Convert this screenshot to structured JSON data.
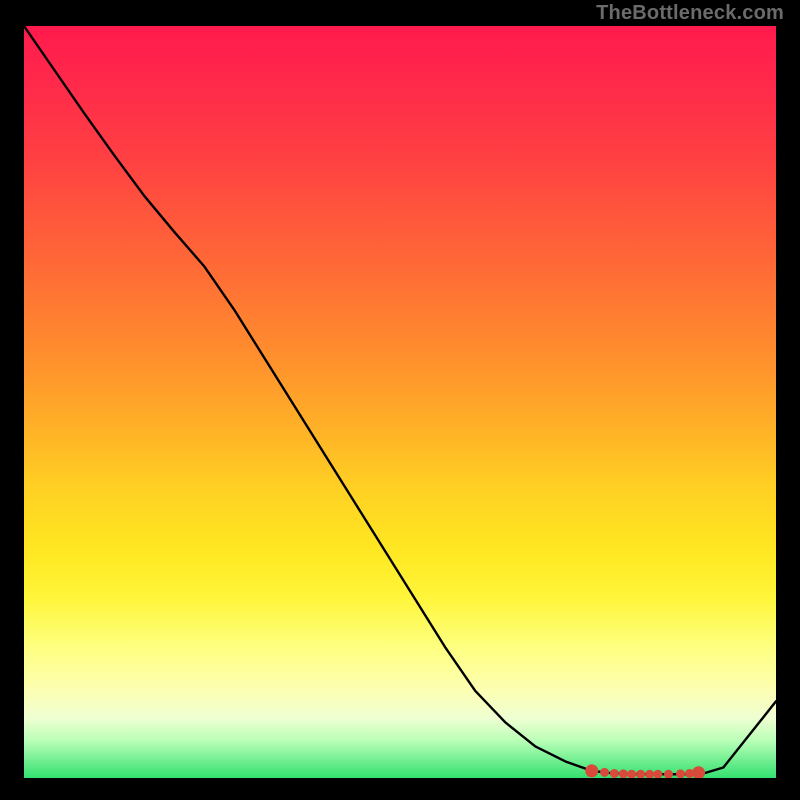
{
  "attribution": "TheBottleneck.com",
  "chart_data": {
    "type": "line",
    "title": "",
    "xlabel": "",
    "ylabel": "",
    "x": [
      0.0,
      0.04,
      0.08,
      0.12,
      0.16,
      0.2,
      0.24,
      0.28,
      0.32,
      0.36,
      0.4,
      0.44,
      0.48,
      0.52,
      0.56,
      0.6,
      0.64,
      0.68,
      0.72,
      0.755,
      0.78,
      0.8,
      0.82,
      0.835,
      0.852,
      0.87,
      0.885,
      0.905,
      0.93,
      0.965,
      1.0
    ],
    "y": [
      1.0,
      0.942,
      0.884,
      0.828,
      0.774,
      0.726,
      0.68,
      0.622,
      0.558,
      0.494,
      0.43,
      0.366,
      0.302,
      0.238,
      0.174,
      0.116,
      0.074,
      0.042,
      0.022,
      0.0095,
      0.0065,
      0.0055,
      0.005,
      0.005,
      0.005,
      0.005,
      0.005,
      0.0065,
      0.014,
      0.058,
      0.102
    ],
    "xlim": [
      0,
      1
    ],
    "ylim_note": "y values are normalized chart-height fractions measured from the bottom of the gradient plot area",
    "marker_cluster": {
      "x": [
        0.755,
        0.772,
        0.785,
        0.797,
        0.808,
        0.82,
        0.832,
        0.843,
        0.857,
        0.873,
        0.885,
        0.897
      ],
      "y": [
        0.0095,
        0.0075,
        0.006,
        0.0055,
        0.005,
        0.005,
        0.005,
        0.005,
        0.005,
        0.0055,
        0.006,
        0.007
      ],
      "radius": [
        6,
        4,
        4,
        4,
        4,
        4,
        4,
        4,
        4,
        4,
        4,
        6
      ]
    }
  }
}
